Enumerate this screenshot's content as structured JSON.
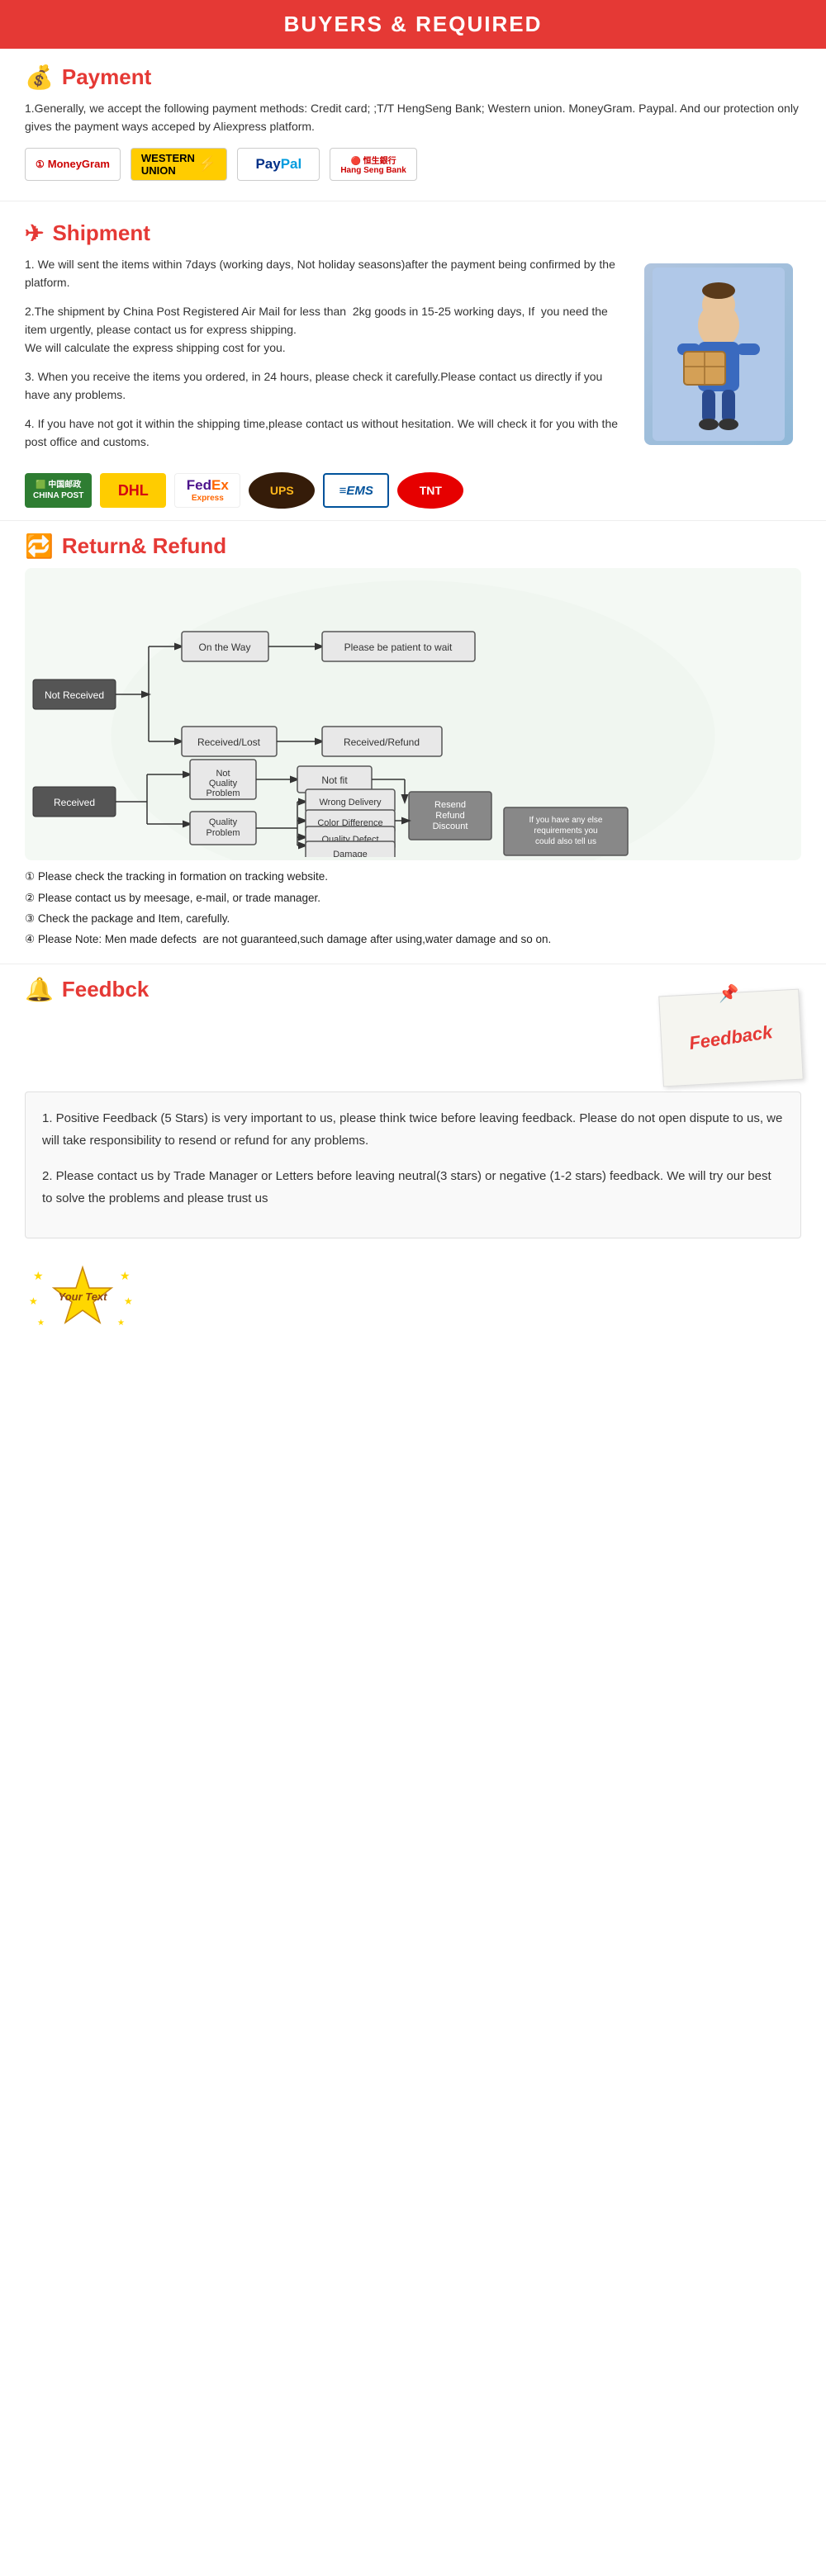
{
  "header": {
    "title": "BUYERS & REQUIRED"
  },
  "payment": {
    "icon": "💰",
    "title": "Payment",
    "description": "1.Generally, we accept the following payment methods: Credit card; ;T/T HengSeng Bank; Western union. MoneyGram. Paypal. And our protection only gives the payment ways acceped by Aliexpress platform.",
    "logos": [
      {
        "name": "MoneyGram",
        "type": "moneygram"
      },
      {
        "name": "WESTERN UNION",
        "type": "westernunion"
      },
      {
        "name": "PayPal",
        "type": "paypal"
      },
      {
        "name": "恒生銀行 Hang Seng Bank",
        "type": "heng"
      }
    ]
  },
  "shipment": {
    "icon": "✈",
    "title": "Shipment",
    "paragraphs": [
      "1. We will sent the items within 7days (working days, Not holiday seasons)after the payment being confirmed by the platform.",
      "2.The shipment by China Post Registered Air Mail for less than  2kg goods in 15-25 working days, If  you need the item urgently, please contact us for express shipping.\nWe will calculate the express shipping cost for you.",
      "3. When you receive the items you ordered, in 24 hours, please check it carefully.Please contact us directly if you have any problems.",
      "4. If you have not got it within the shipping time,please contact us without hesitation. We will check it for you with the post office and customs."
    ],
    "logos": [
      {
        "name": "中国邮政 CHINA POST",
        "type": "chinapost"
      },
      {
        "name": "DHL",
        "type": "dhl"
      },
      {
        "name": "FedEx Express",
        "type": "fedex"
      },
      {
        "name": "UPS",
        "type": "ups"
      },
      {
        "name": "EMS",
        "type": "ems"
      },
      {
        "name": "TNT",
        "type": "tnt"
      }
    ]
  },
  "refund": {
    "icon": "🔁",
    "title": "Return& Refund",
    "diagram": {
      "not_received": "Not Received",
      "on_the_way": "On the Way",
      "please_wait": "Please be patient to wait",
      "received_lost": "Received/Lost",
      "received_refund": "Received/Refund",
      "received": "Received",
      "not_quality_problem": "Not\nQuality\nProblem",
      "quality_problem": "Quality\nProblem",
      "not_fit": "Not fit",
      "wrong_delivery": "Wrong Delivery",
      "color_difference": "Color Difference",
      "quality_defect": "Quality Defect",
      "damage": "Damage",
      "resend_refund": "Resend\nRefund\nDiscount",
      "else_requirements": "If you have any else\nrequirements you\ncould also tell us"
    },
    "notes": [
      "① Please check the tracking in formation on tracking website.",
      "② Please contact us by meesage, e-mail, or trade manager.",
      "③ Check the package and Item, carefully.",
      "④ Please Note: Men made defects  are not guaranteed,such damage after using,water damage and so on."
    ]
  },
  "feedback": {
    "icon": "🔔",
    "title": "Feedbck",
    "note_card": "Feedback",
    "paragraphs": [
      "1. Positive Feedback (5 Stars) is very important to us, please think twice before leaving feedback. Please do not open dispute to us,   we will take responsibility to resend or refund for any problems.",
      "2. Please contact us by Trade Manager or Letters before leaving neutral(3 stars) or negative (1-2 stars) feedback. We will try our best to solve the problems and please trust us"
    ],
    "badge_text": "Your Text"
  }
}
